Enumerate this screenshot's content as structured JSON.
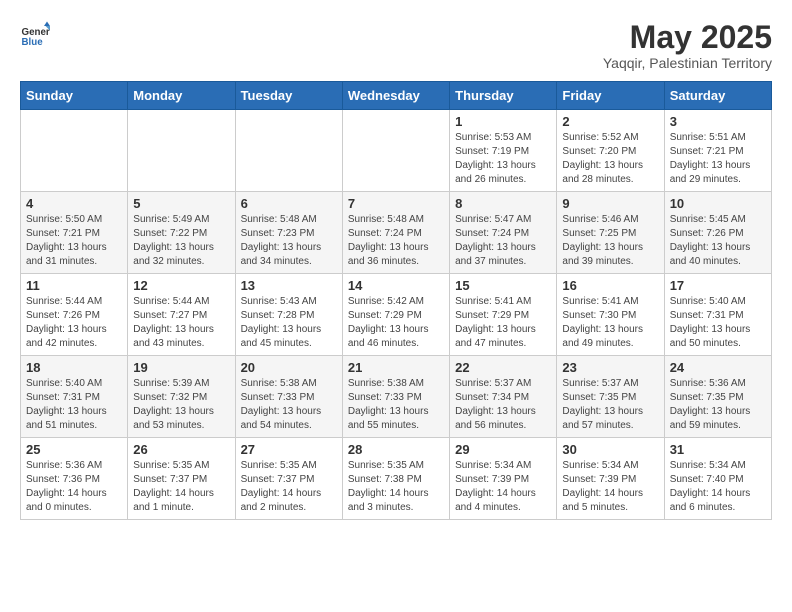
{
  "header": {
    "logo_general": "General",
    "logo_blue": "Blue",
    "title": "May 2025",
    "subtitle": "Yaqqir, Palestinian Territory"
  },
  "days_of_week": [
    "Sunday",
    "Monday",
    "Tuesday",
    "Wednesday",
    "Thursday",
    "Friday",
    "Saturday"
  ],
  "weeks": [
    [
      {
        "day": "",
        "info": ""
      },
      {
        "day": "",
        "info": ""
      },
      {
        "day": "",
        "info": ""
      },
      {
        "day": "",
        "info": ""
      },
      {
        "day": "1",
        "info": "Sunrise: 5:53 AM\nSunset: 7:19 PM\nDaylight: 13 hours\nand 26 minutes."
      },
      {
        "day": "2",
        "info": "Sunrise: 5:52 AM\nSunset: 7:20 PM\nDaylight: 13 hours\nand 28 minutes."
      },
      {
        "day": "3",
        "info": "Sunrise: 5:51 AM\nSunset: 7:21 PM\nDaylight: 13 hours\nand 29 minutes."
      }
    ],
    [
      {
        "day": "4",
        "info": "Sunrise: 5:50 AM\nSunset: 7:21 PM\nDaylight: 13 hours\nand 31 minutes."
      },
      {
        "day": "5",
        "info": "Sunrise: 5:49 AM\nSunset: 7:22 PM\nDaylight: 13 hours\nand 32 minutes."
      },
      {
        "day": "6",
        "info": "Sunrise: 5:48 AM\nSunset: 7:23 PM\nDaylight: 13 hours\nand 34 minutes."
      },
      {
        "day": "7",
        "info": "Sunrise: 5:48 AM\nSunset: 7:24 PM\nDaylight: 13 hours\nand 36 minutes."
      },
      {
        "day": "8",
        "info": "Sunrise: 5:47 AM\nSunset: 7:24 PM\nDaylight: 13 hours\nand 37 minutes."
      },
      {
        "day": "9",
        "info": "Sunrise: 5:46 AM\nSunset: 7:25 PM\nDaylight: 13 hours\nand 39 minutes."
      },
      {
        "day": "10",
        "info": "Sunrise: 5:45 AM\nSunset: 7:26 PM\nDaylight: 13 hours\nand 40 minutes."
      }
    ],
    [
      {
        "day": "11",
        "info": "Sunrise: 5:44 AM\nSunset: 7:26 PM\nDaylight: 13 hours\nand 42 minutes."
      },
      {
        "day": "12",
        "info": "Sunrise: 5:44 AM\nSunset: 7:27 PM\nDaylight: 13 hours\nand 43 minutes."
      },
      {
        "day": "13",
        "info": "Sunrise: 5:43 AM\nSunset: 7:28 PM\nDaylight: 13 hours\nand 45 minutes."
      },
      {
        "day": "14",
        "info": "Sunrise: 5:42 AM\nSunset: 7:29 PM\nDaylight: 13 hours\nand 46 minutes."
      },
      {
        "day": "15",
        "info": "Sunrise: 5:41 AM\nSunset: 7:29 PM\nDaylight: 13 hours\nand 47 minutes."
      },
      {
        "day": "16",
        "info": "Sunrise: 5:41 AM\nSunset: 7:30 PM\nDaylight: 13 hours\nand 49 minutes."
      },
      {
        "day": "17",
        "info": "Sunrise: 5:40 AM\nSunset: 7:31 PM\nDaylight: 13 hours\nand 50 minutes."
      }
    ],
    [
      {
        "day": "18",
        "info": "Sunrise: 5:40 AM\nSunset: 7:31 PM\nDaylight: 13 hours\nand 51 minutes."
      },
      {
        "day": "19",
        "info": "Sunrise: 5:39 AM\nSunset: 7:32 PM\nDaylight: 13 hours\nand 53 minutes."
      },
      {
        "day": "20",
        "info": "Sunrise: 5:38 AM\nSunset: 7:33 PM\nDaylight: 13 hours\nand 54 minutes."
      },
      {
        "day": "21",
        "info": "Sunrise: 5:38 AM\nSunset: 7:33 PM\nDaylight: 13 hours\nand 55 minutes."
      },
      {
        "day": "22",
        "info": "Sunrise: 5:37 AM\nSunset: 7:34 PM\nDaylight: 13 hours\nand 56 minutes."
      },
      {
        "day": "23",
        "info": "Sunrise: 5:37 AM\nSunset: 7:35 PM\nDaylight: 13 hours\nand 57 minutes."
      },
      {
        "day": "24",
        "info": "Sunrise: 5:36 AM\nSunset: 7:35 PM\nDaylight: 13 hours\nand 59 minutes."
      }
    ],
    [
      {
        "day": "25",
        "info": "Sunrise: 5:36 AM\nSunset: 7:36 PM\nDaylight: 14 hours\nand 0 minutes."
      },
      {
        "day": "26",
        "info": "Sunrise: 5:35 AM\nSunset: 7:37 PM\nDaylight: 14 hours\nand 1 minute."
      },
      {
        "day": "27",
        "info": "Sunrise: 5:35 AM\nSunset: 7:37 PM\nDaylight: 14 hours\nand 2 minutes."
      },
      {
        "day": "28",
        "info": "Sunrise: 5:35 AM\nSunset: 7:38 PM\nDaylight: 14 hours\nand 3 minutes."
      },
      {
        "day": "29",
        "info": "Sunrise: 5:34 AM\nSunset: 7:39 PM\nDaylight: 14 hours\nand 4 minutes."
      },
      {
        "day": "30",
        "info": "Sunrise: 5:34 AM\nSunset: 7:39 PM\nDaylight: 14 hours\nand 5 minutes."
      },
      {
        "day": "31",
        "info": "Sunrise: 5:34 AM\nSunset: 7:40 PM\nDaylight: 14 hours\nand 6 minutes."
      }
    ]
  ]
}
